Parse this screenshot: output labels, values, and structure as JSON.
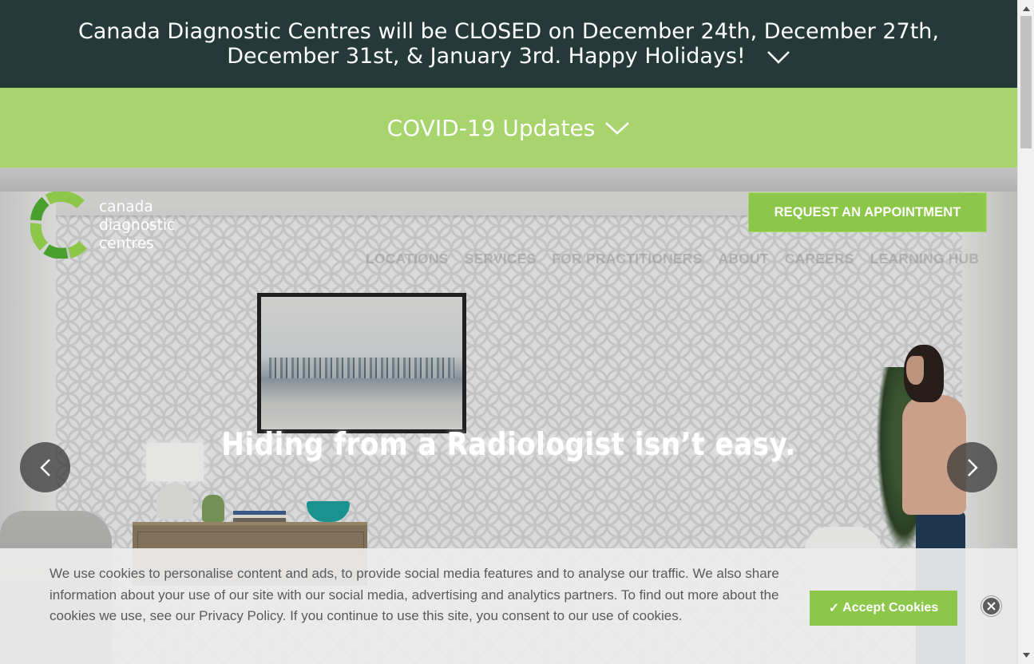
{
  "announcement": {
    "text": "Canada Diagnostic Centres will be CLOSED on December 24th, December 27th, December 31st, & January 3rd. Happy Holidays!",
    "chevron_icon": "chevron-down-icon"
  },
  "covid": {
    "label": "COVID-19 Updates",
    "chevron_icon": "chevron-down-icon"
  },
  "logo": {
    "line1": "canada",
    "line2": "diagnostic",
    "line3": "centres"
  },
  "header": {
    "appointment_label": "REQUEST AN APPOINTMENT"
  },
  "nav": {
    "items": [
      "LOCATIONS",
      "SERVICES",
      "FOR PRACTITIONERS",
      "ABOUT",
      "CAREERS",
      "LEARNING HUB"
    ]
  },
  "hero": {
    "headline": "Hiding from a Radiologist isn’t easy.",
    "prev_icon": "chevron-left-icon",
    "next_icon": "chevron-right-icon"
  },
  "cookie": {
    "text": "We use cookies to personalise content and ads, to provide social media features and to analyse our traffic. We also share information about your use of our site with our social media, advertising and analytics partners. To find out more about the cookies we use, see our Privacy Policy. If you continue to use this site, you consent to our use of cookies.",
    "accept_label": "Accept Cookies",
    "accept_icon": "checkmark-icon",
    "close_icon": "close-icon"
  },
  "colors": {
    "announcement_bg": "#253a38",
    "covid_bg": "#a7d46d",
    "brand_green": "#8cc74a",
    "logo_dark_green": "#4aa02c"
  }
}
